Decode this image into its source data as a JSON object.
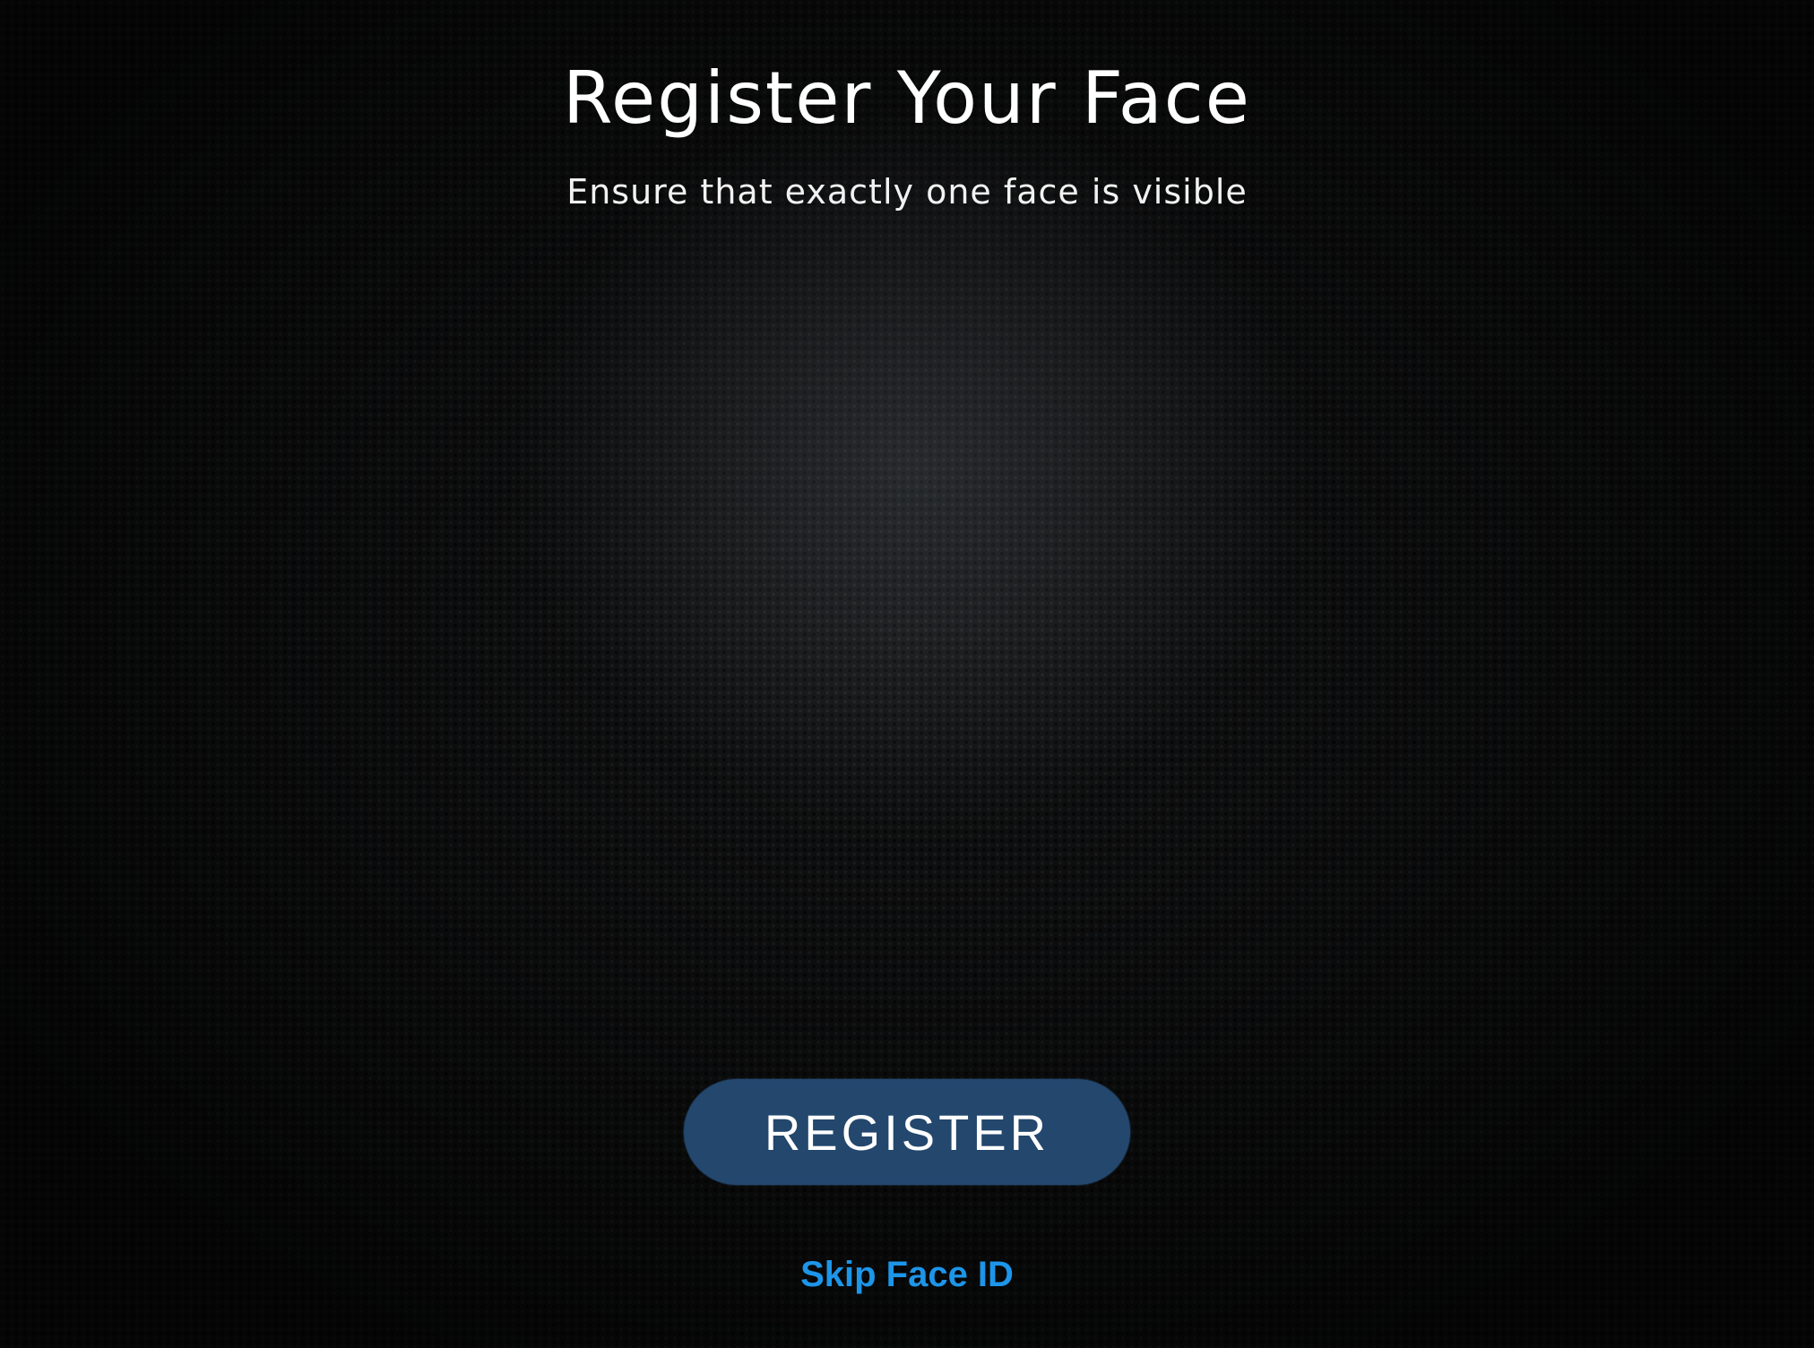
{
  "header": {
    "title": "Register Your Face",
    "subtitle": "Ensure that exactly one face is visible"
  },
  "actions": {
    "register_label": "REGISTER",
    "skip_label": "Skip Face ID"
  },
  "colors": {
    "button_background": "#23476d",
    "link": "#1d95e8",
    "text": "#ffffff"
  }
}
